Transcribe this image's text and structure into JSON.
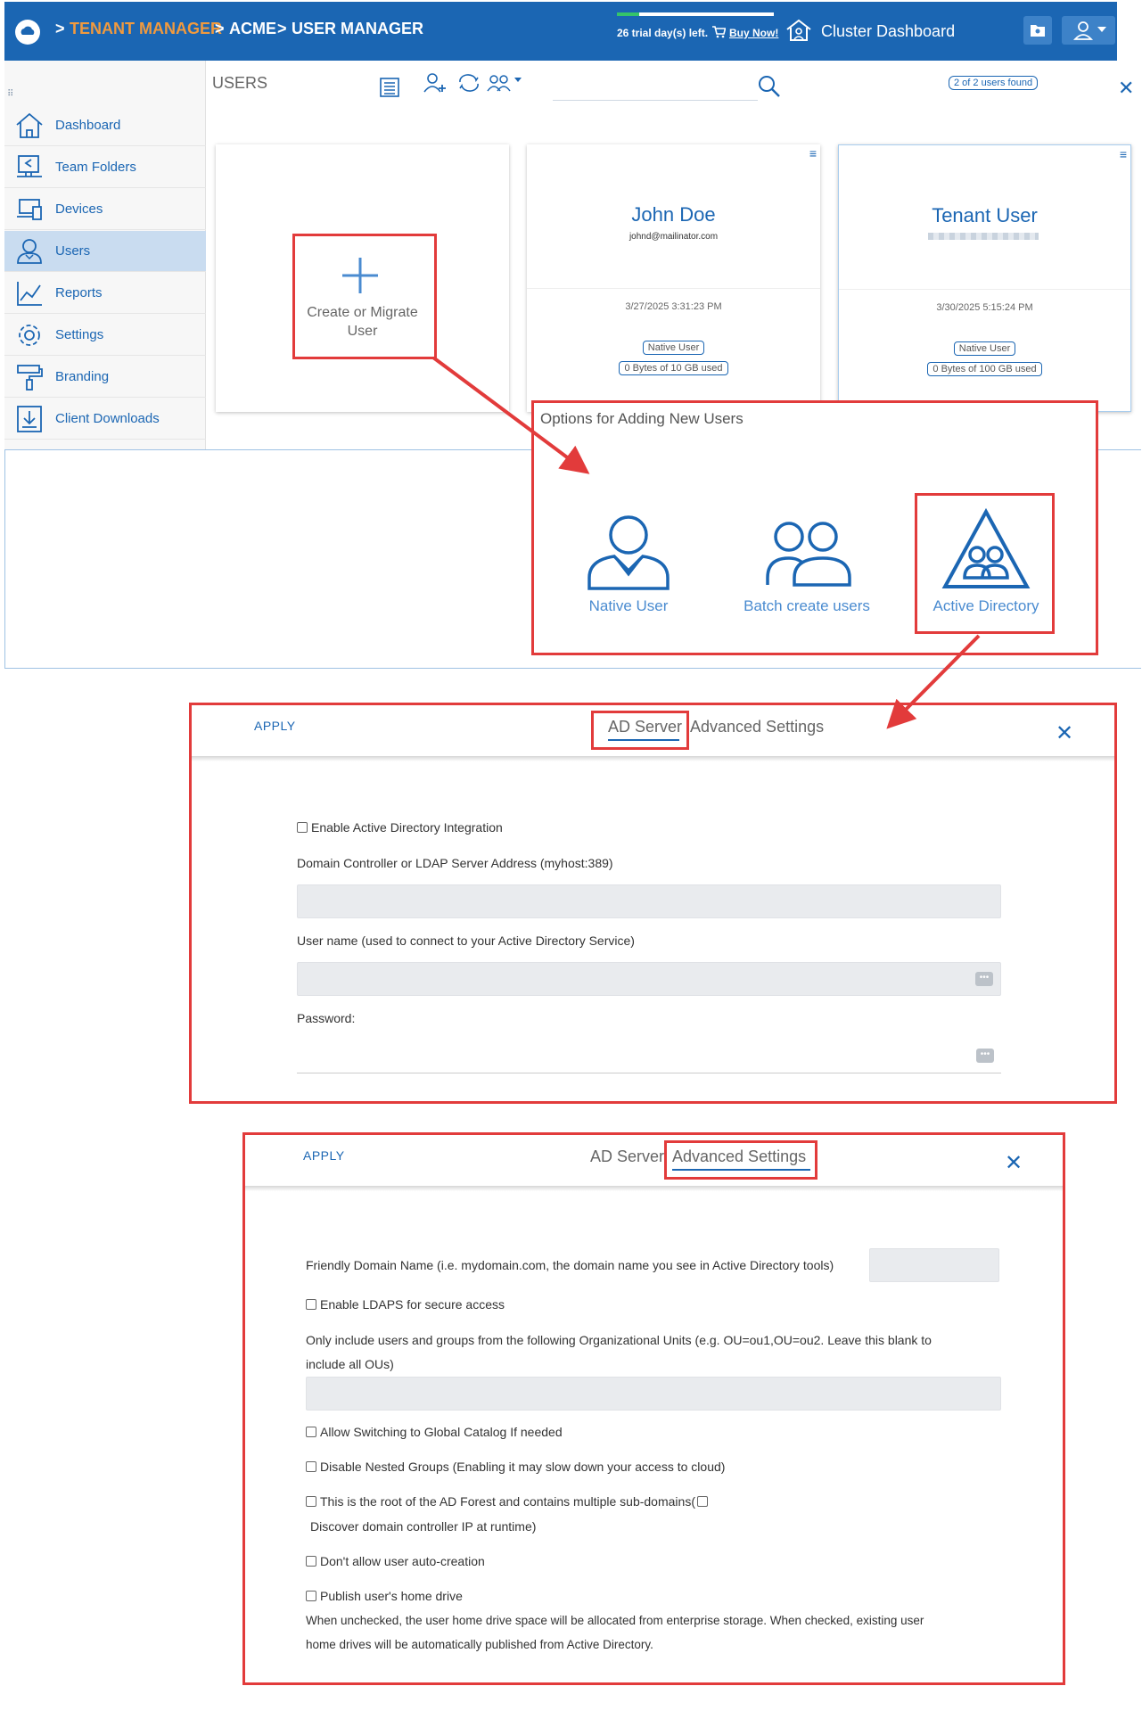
{
  "header": {
    "crumb_sep": ">",
    "crumb1": "TENANT MANAGER",
    "crumb2": "ACME",
    "crumb3": "USER MANAGER",
    "trial_text": "26 trial day(s) left.",
    "buy_now": "Buy Now!",
    "cluster_dashboard": "Cluster Dashboard",
    "trial_progress": 0.14
  },
  "sidebar": {
    "items": [
      {
        "label": "Dashboard",
        "icon": "house-icon"
      },
      {
        "label": "Team Folders",
        "icon": "share-screen-icon"
      },
      {
        "label": "Devices",
        "icon": "devices-icon"
      },
      {
        "label": "Users",
        "icon": "user-icon"
      },
      {
        "label": "Reports",
        "icon": "chart-icon"
      },
      {
        "label": "Settings",
        "icon": "gear-icon"
      },
      {
        "label": "Branding",
        "icon": "paint-roller-icon"
      },
      {
        "label": "Client Downloads",
        "icon": "download-icon"
      }
    ]
  },
  "users": {
    "title": "USERS",
    "found": "2 of 2 users found",
    "create_line1": "Create or Migrate",
    "create_line2": "User",
    "cards": [
      {
        "name": "John Doe",
        "email": "johnd@mailinator.com",
        "date": "3/27/2025 3:31:23 PM",
        "type": "Native User",
        "usage": "0 Bytes of 10 GB used"
      },
      {
        "name": "Tenant User",
        "email": "",
        "date": "3/30/2025 5:15:24 PM",
        "type": "Native User",
        "usage": "0 Bytes of 100 GB used"
      }
    ]
  },
  "options": {
    "title": "Options for Adding New Users",
    "native": "Native User",
    "batch": "Batch create users",
    "ad": "Active Directory"
  },
  "dialog1": {
    "apply": "APPLY",
    "tab_ad": "AD Server",
    "tab_adv": "Advanced Settings",
    "enable_ad": "Enable Active Directory Integration",
    "dc_label": "Domain Controller or LDAP Server Address (myhost:389)",
    "user_label": "User name (used to connect to your Active Directory Service)",
    "password_label": "Password:",
    "dots": "•••"
  },
  "dialog2": {
    "apply": "APPLY",
    "tab_ad": "AD Server",
    "tab_adv": "Advanced Settings",
    "friendly": "Friendly Domain Name (i.e. mydomain.com, the domain name you see in Active Directory tools)",
    "ldaps": "Enable LDAPS for secure access",
    "ou_line1": "Only include users and groups from the following Organizational Units (e.g. OU=ou1,OU=ou2. Leave this blank to",
    "ou_line2": "include all OUs)",
    "global_catalog": "Allow Switching to Global Catalog If needed",
    "nested": "Disable Nested Groups (Enabling it may slow down your access to cloud)",
    "root_forest": "This is the root of the AD Forest and contains multiple sub-domains(",
    "discover": "Discover domain controller IP at runtime)",
    "no_autocreate": "Don't allow user auto-creation",
    "publish": "Publish user's home drive",
    "publish_note1": "When unchecked, the user home drive space will be allocated from enterprise storage. When checked, existing user",
    "publish_note2": "home drives will be automatically published from Active Directory."
  }
}
